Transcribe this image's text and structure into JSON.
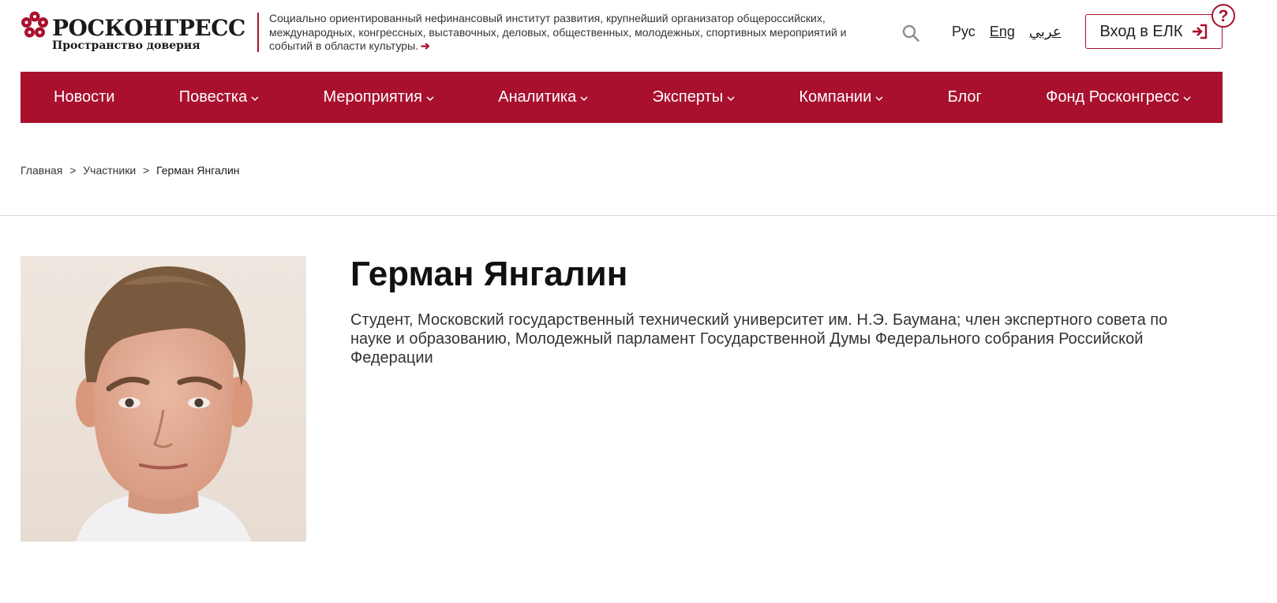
{
  "header": {
    "logo_name": "РОСКОНГРЕСС",
    "logo_tagline": "Пространство доверия",
    "description": "Социально ориентированный нефинансовый институт развития, крупнейший организатор общероссийских, международных, конгрессных, выставочных, деловых, общественных, молодежных, спортивных мероприятий и событий в области культуры.",
    "languages": [
      {
        "label": "Рус"
      },
      {
        "label": "Eng"
      },
      {
        "label": "عربي"
      }
    ],
    "login_label": "Вход в ЕЛК",
    "help_label": "?",
    "brand_color": "#a8102e"
  },
  "nav": {
    "items": [
      {
        "label": "Новости"
      },
      {
        "label": "Повестка"
      },
      {
        "label": "Мероприятия"
      },
      {
        "label": "Аналитика"
      },
      {
        "label": "Эксперты"
      },
      {
        "label": "Компании"
      },
      {
        "label": "Блог"
      },
      {
        "label": "Фонд Росконгресс"
      }
    ]
  },
  "breadcrumb": {
    "home": "Главная",
    "separator": ">",
    "section": "Участники",
    "current": "Герман Янгалин"
  },
  "profile": {
    "name": "Герман Янгалин",
    "bio": "Студент, Московский государственный технический университет им. Н.Э. Баумана; член экспертного совета по науке и образованию, Молодежный парламент Государственной Думы Федерального собрания Российской Федерации"
  }
}
